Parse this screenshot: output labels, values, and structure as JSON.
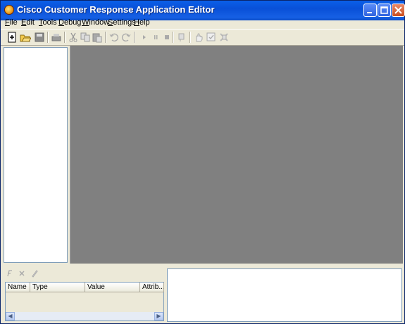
{
  "window": {
    "title": "Cisco Customer Response Application Editor"
  },
  "menu": {
    "items": [
      {
        "label": "File"
      },
      {
        "label": "Edit"
      },
      {
        "label": "Tools"
      },
      {
        "label": "Debug"
      },
      {
        "label": "Window"
      },
      {
        "label": "Settings"
      },
      {
        "label": "Help"
      }
    ]
  },
  "toolbar": {
    "buttons": [
      "new-icon",
      "open-icon",
      "save-icon",
      "print-icon",
      "cut-icon",
      "copy-icon",
      "paste-icon",
      "undo-icon",
      "redo-icon",
      "run-icon",
      "pause-icon",
      "stop-icon",
      "insert-breakpoint-icon",
      "clear-breakpoint-icon",
      "hand-icon",
      "validate-icon"
    ]
  },
  "variables": {
    "columns": [
      "Name",
      "Type",
      "Value",
      "Attrib..."
    ]
  },
  "colors": {
    "canvas": "#808080",
    "titlebar": "#0a5fe8",
    "chrome": "#ece9d8"
  }
}
